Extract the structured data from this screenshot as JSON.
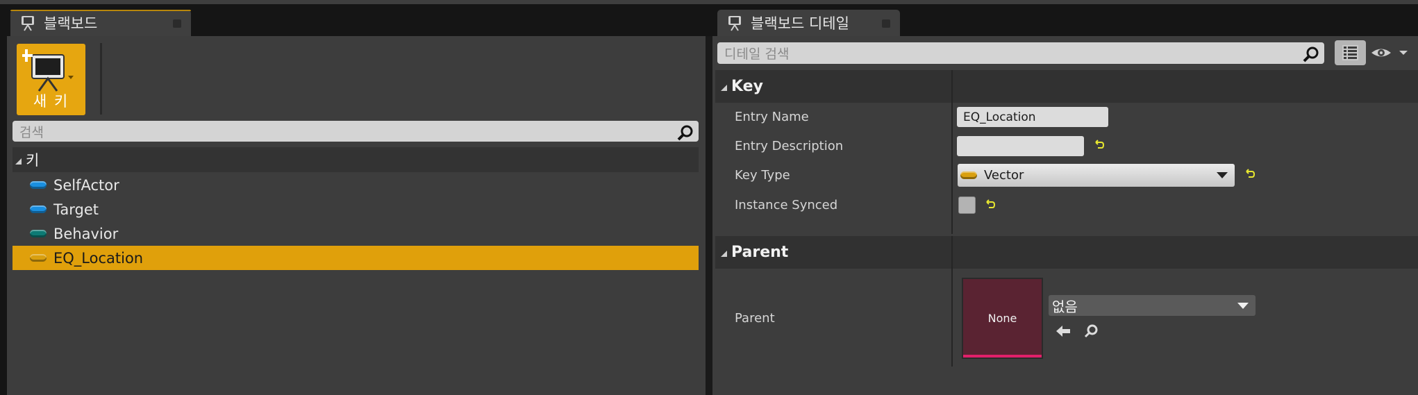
{
  "left_tab": {
    "title": "블랙보드"
  },
  "right_tab": {
    "title": "블랙보드 디테일"
  },
  "toolbar": {
    "new_key_label": "새 키"
  },
  "left_search": {
    "placeholder": "검색",
    "value": ""
  },
  "key_list": {
    "category": "키",
    "items": [
      {
        "label": "SelfActor",
        "color": "#1a8fe0"
      },
      {
        "label": "Target",
        "color": "#1a8fe0"
      },
      {
        "label": "Behavior",
        "color": "#0d7a74"
      },
      {
        "label": "EQ_Location",
        "color": "#d9a010",
        "selected": true
      }
    ]
  },
  "details_search": {
    "placeholder": "디테일 검색",
    "value": ""
  },
  "sections": {
    "key": {
      "title": "Key",
      "entry_name_label": "Entry Name",
      "entry_name_value": "EQ_Location",
      "entry_description_label": "Entry Description",
      "entry_description_value": "",
      "key_type_label": "Key Type",
      "key_type_value": "Vector",
      "instance_synced_label": "Instance Synced",
      "instance_synced_checked": false
    },
    "parent": {
      "title": "Parent",
      "parent_label": "Parent",
      "thumbnail_label": "None",
      "combo_value": "없음"
    }
  },
  "colors": {
    "accent_orange": "#e0a00b",
    "panel_bg": "#3d3d3d",
    "reset_arrow": "#e8e830"
  }
}
